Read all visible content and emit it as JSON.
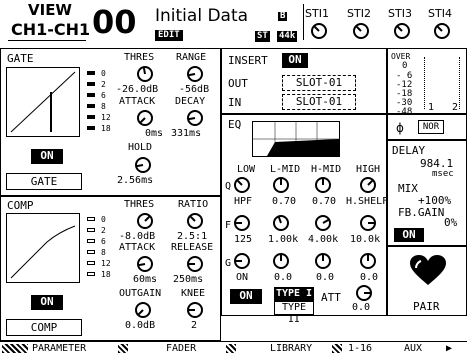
{
  "header": {
    "view_label": "VIEW",
    "channel_label": "CH1-CH1",
    "scene_number": "00",
    "scene_title": "Initial Data",
    "edit_badge": "EDIT",
    "st_badge": "ST",
    "rate_badge": "44k",
    "b_badge": "B",
    "st_inputs": [
      "STI1",
      "STI2",
      "STI3",
      "STI4"
    ]
  },
  "gate": {
    "title": "GATE",
    "thres_label": "THRES",
    "thres_value": "-26.0dB",
    "range_label": "RANGE",
    "range_value": "-56dB",
    "attack_label": "ATTACK",
    "attack_value": "0ms",
    "decay_label": "DECAY",
    "decay_value": "331ms",
    "hold_label": "HOLD",
    "hold_value": "2.56ms",
    "meter_scale": [
      "0",
      "2",
      "6",
      "8",
      "12",
      "18"
    ],
    "on_label": "ON",
    "type_label": "GATE"
  },
  "comp": {
    "title": "COMP",
    "thres_label": "THRES",
    "thres_value": "-8.0dB",
    "ratio_label": "RATIO",
    "ratio_value": "2.5:1",
    "attack_label": "ATTACK",
    "attack_value": "60ms",
    "release_label": "RELEASE",
    "release_value": "250ms",
    "outgain_label": "OUTGAIN",
    "outgain_value": "0.0dB",
    "knee_label": "KNEE",
    "knee_value": "2",
    "meter_scale": [
      "0",
      "2",
      "6",
      "8",
      "12",
      "18"
    ],
    "on_label": "ON",
    "type_label": "COMP"
  },
  "insert": {
    "label": "INSERT",
    "on_label": "ON",
    "out_label": "OUT",
    "out_value": "SLOT-01",
    "in_label": "IN",
    "in_value": "SLOT-01"
  },
  "eq": {
    "label": "EQ",
    "bands": [
      "LOW",
      "L-MID",
      "H-MID",
      "HIGH"
    ],
    "q_label": "Q",
    "q_values": [
      "HPF",
      "0.70",
      "0.70",
      "H.SHELF"
    ],
    "f_label": "F",
    "f_values": [
      "125",
      "1.00k",
      "4.00k",
      "10.0k"
    ],
    "g_label": "G",
    "g_values": [
      "ON",
      "0.0",
      "0.0",
      "0.0"
    ],
    "on_label": "ON",
    "type1_label": "TYPE I",
    "type2_label": "TYPE II",
    "att_label": "ATT",
    "att_value": "0.0"
  },
  "meter": {
    "over_label": "OVER",
    "scale": [
      "0",
      "- 6",
      "-12",
      "-18",
      "-30",
      "-48"
    ],
    "channels": [
      "1",
      "2"
    ]
  },
  "phase": {
    "symbol": "ϕ",
    "value": "NOR"
  },
  "delay": {
    "label": "DELAY",
    "time_value": "984.1",
    "time_unit": "msec",
    "mix_label": "MIX",
    "mix_value": "+100%",
    "fbgain_label": "FB.GAIN",
    "fbgain_value": "0%",
    "on_label": "ON"
  },
  "pair": {
    "label": "PAIR"
  },
  "tabs": [
    "PARAMETER",
    "FADER",
    "LIBRARY",
    "1-16",
    "AUX"
  ]
}
